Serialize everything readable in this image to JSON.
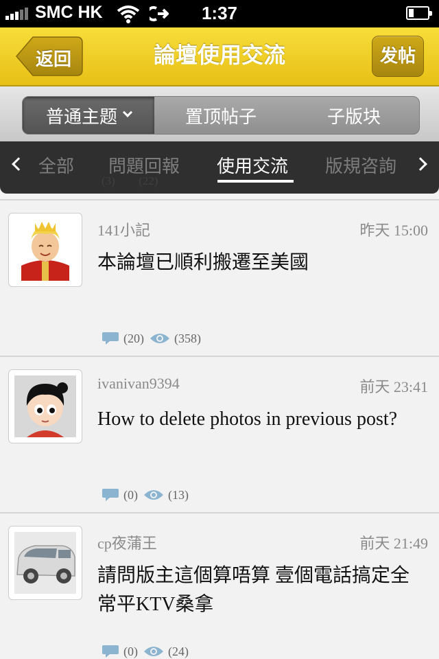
{
  "status_bar": {
    "carrier": "SMC HK",
    "time": "1:37"
  },
  "nav": {
    "back_label": "返回",
    "title": "論壇使用交流",
    "post_label": "发帖"
  },
  "segments": [
    {
      "label": "普通主题"
    },
    {
      "label": "置顶帖子"
    },
    {
      "label": "子版块"
    }
  ],
  "categories": [
    {
      "label": "全部"
    },
    {
      "label": "問題回報"
    },
    {
      "label": "使用交流"
    },
    {
      "label": "版規咨詢"
    }
  ],
  "partial_row": {
    "replies": "(3)",
    "views": "(22)"
  },
  "posts": [
    {
      "author": "141小記",
      "time": "昨天 15:00",
      "title": "本論壇已順利搬遷至美國",
      "replies": "(20)",
      "views": "(358)"
    },
    {
      "author": "ivanivan9394",
      "time": "前天 23:41",
      "title": "How to delete photos in previous post?",
      "replies": "(0)",
      "views": "(13)"
    },
    {
      "author": "cp夜蒲王",
      "time": "前天 21:49",
      "title": "請問版主這個算唔算 壹個電話搞定全常平KTV桑拿",
      "replies": "(0)",
      "views": "(24)"
    }
  ],
  "colors": {
    "nav_yellow": "#f2cf26",
    "icon_blue": "#8ab4cf"
  }
}
